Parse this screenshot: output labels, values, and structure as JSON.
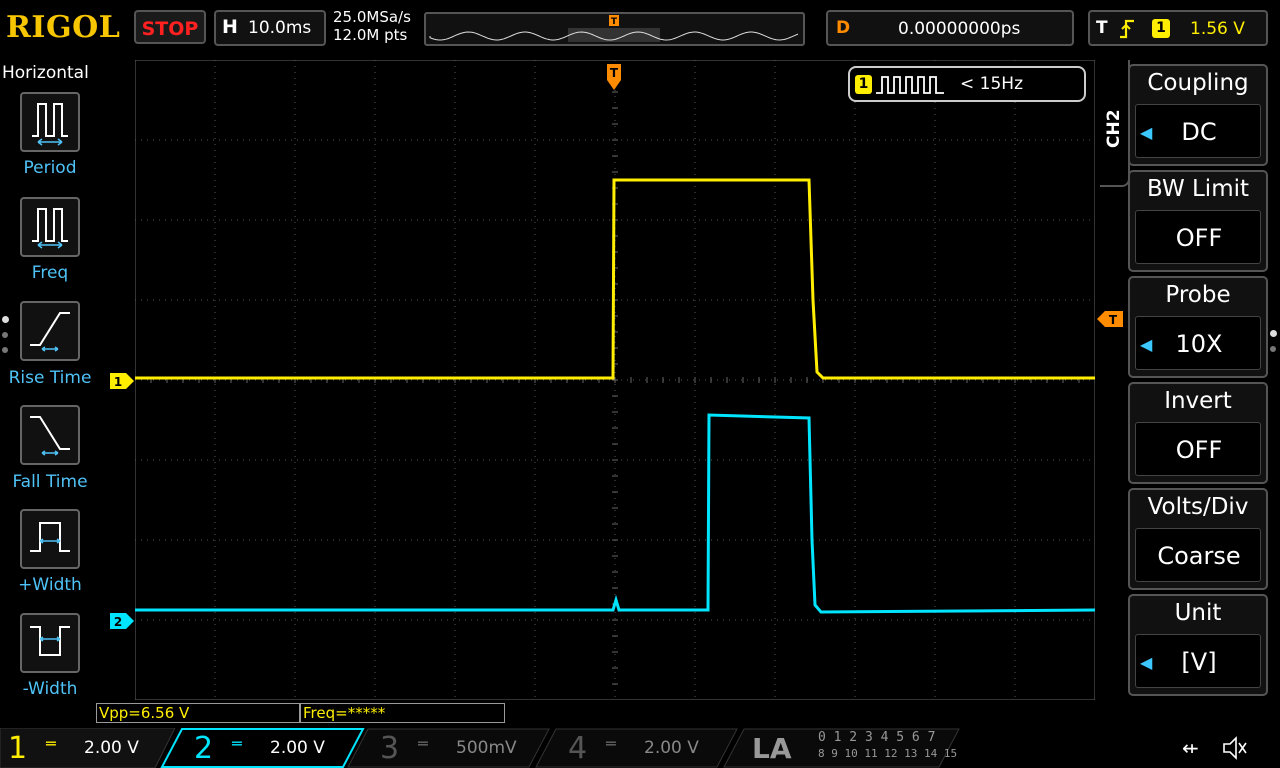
{
  "header": {
    "logo": "RIGOL",
    "run_state": "STOP",
    "horizontal_letter": "H",
    "timebase": "10.0ms",
    "sample_rate": "25.0MSa/s",
    "memory_depth": "12.0M pts",
    "delay_letter": "D",
    "delay": "0.00000000ps",
    "trigger_letter": "T",
    "trigger_channel": "1",
    "trigger_level": "1.56 V"
  },
  "left_panel": {
    "title": "Horizontal",
    "items": [
      {
        "label": "Period",
        "icon": "period-icon"
      },
      {
        "label": "Freq",
        "icon": "freq-icon"
      },
      {
        "label": "Rise Time",
        "icon": "rise-time-icon"
      },
      {
        "label": "Fall Time",
        "icon": "fall-time-icon"
      },
      {
        "label": "+Width",
        "icon": "plus-width-icon"
      },
      {
        "label": "-Width",
        "icon": "minus-width-icon"
      }
    ]
  },
  "screen": {
    "trigger_marker": "T",
    "ch1_marker": "1",
    "ch2_marker": "2",
    "freq_badge_channel": "1",
    "freq_badge_text": "< 15Hz"
  },
  "right_panel": {
    "channel_tag": "CH2",
    "items": [
      {
        "title": "Coupling",
        "value": "DC",
        "has_arrow": true
      },
      {
        "title": "BW Limit",
        "value": "OFF",
        "has_arrow": false
      },
      {
        "title": "Probe",
        "value": "10X",
        "has_arrow": true
      },
      {
        "title": "Invert",
        "value": "OFF",
        "has_arrow": false
      },
      {
        "title": "Volts/Div",
        "value": "Coarse",
        "has_arrow": false
      },
      {
        "title": "Unit",
        "value": "[V]",
        "has_arrow": true
      }
    ]
  },
  "measurements": {
    "vpp": "Vpp=6.56 V",
    "freq": "Freq=*****"
  },
  "channels": [
    {
      "num": "1",
      "scale": "2.00 V",
      "color": "#ffee00"
    },
    {
      "num": "2",
      "scale": "2.00 V",
      "color": "#00e5ff"
    },
    {
      "num": "3",
      "scale": "500mV",
      "color": "#888888"
    },
    {
      "num": "4",
      "scale": "2.00 V",
      "color": "#888888"
    }
  ],
  "la": {
    "label": "LA",
    "row1": "0 1 2 3   4 5 6 7",
    "row2": "8 9 10 11 12 13 14 15"
  },
  "colors": {
    "ch1": "#ffee00",
    "ch2": "#00e5ff",
    "trigger": "#ff8c00",
    "logo": "#f7c600",
    "stop": "#ff2020",
    "accent_blue": "#4fc3f7"
  }
}
